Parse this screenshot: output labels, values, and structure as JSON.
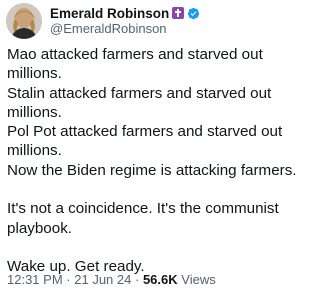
{
  "author": {
    "display_name": "Emerald Robinson",
    "handle": "@EmeraldRobinson",
    "name_emoji": "cross-emoji",
    "verified_color": "#1d9bf0"
  },
  "tweet": {
    "text": "Mao attacked farmers and starved out millions.\nStalin attacked farmers and starved out millions.\nPol Pot attacked farmers and starved out millions.\nNow the Biden regime is attacking farmers.\n\nIt's not a coincidence. It's the communist playbook.\n\nWake up. Get ready."
  },
  "meta": {
    "time": "12:31 PM",
    "separator": "·",
    "date": "21 Jun 24",
    "views_count": "56.6K",
    "views_label": "Views"
  }
}
